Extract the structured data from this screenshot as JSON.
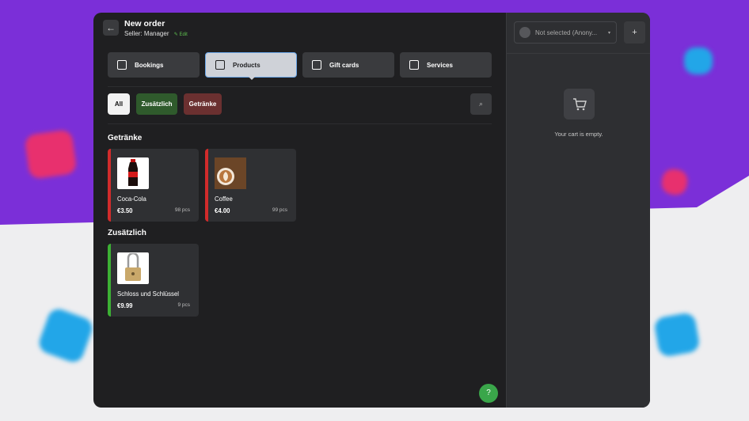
{
  "header": {
    "title": "New order",
    "seller_label": "Seller:",
    "seller_name": "Manager",
    "edit_label": "Edit"
  },
  "tabs": [
    {
      "label": "Bookings",
      "icon": "calendar-icon",
      "active": false
    },
    {
      "label": "Products",
      "icon": "inbox-icon",
      "active": true
    },
    {
      "label": "Gift cards",
      "icon": "gift-icon",
      "active": false
    },
    {
      "label": "Services",
      "icon": "clipboard-icon",
      "active": false
    }
  ],
  "filters": [
    {
      "label": "All",
      "color": "#f2f2f2"
    },
    {
      "label": "Zusätzlich",
      "color": "#2f5a2c"
    },
    {
      "label": "Getränke",
      "color": "#6b3030"
    }
  ],
  "sections": [
    {
      "title": "Getränke",
      "products": [
        {
          "name": "Coca-Cola",
          "price": "€3.50",
          "qty": "98 pcs",
          "color": "#d12b2b",
          "icon": "cola-bottle-image"
        },
        {
          "name": "Coffee",
          "price": "€4.00",
          "qty": "99 pcs",
          "color": "#d12b2b",
          "icon": "coffee-cup-image"
        }
      ]
    },
    {
      "title": "Zusätzlich",
      "products": [
        {
          "name": "Schloss und Schlüssel",
          "price": "€9.99",
          "qty": "9 pcs",
          "color": "#3cb034",
          "icon": "padlock-image"
        }
      ]
    }
  ],
  "cart": {
    "customer_placeholder": "Not selected (Anony...",
    "empty_text": "Your cart is empty."
  }
}
